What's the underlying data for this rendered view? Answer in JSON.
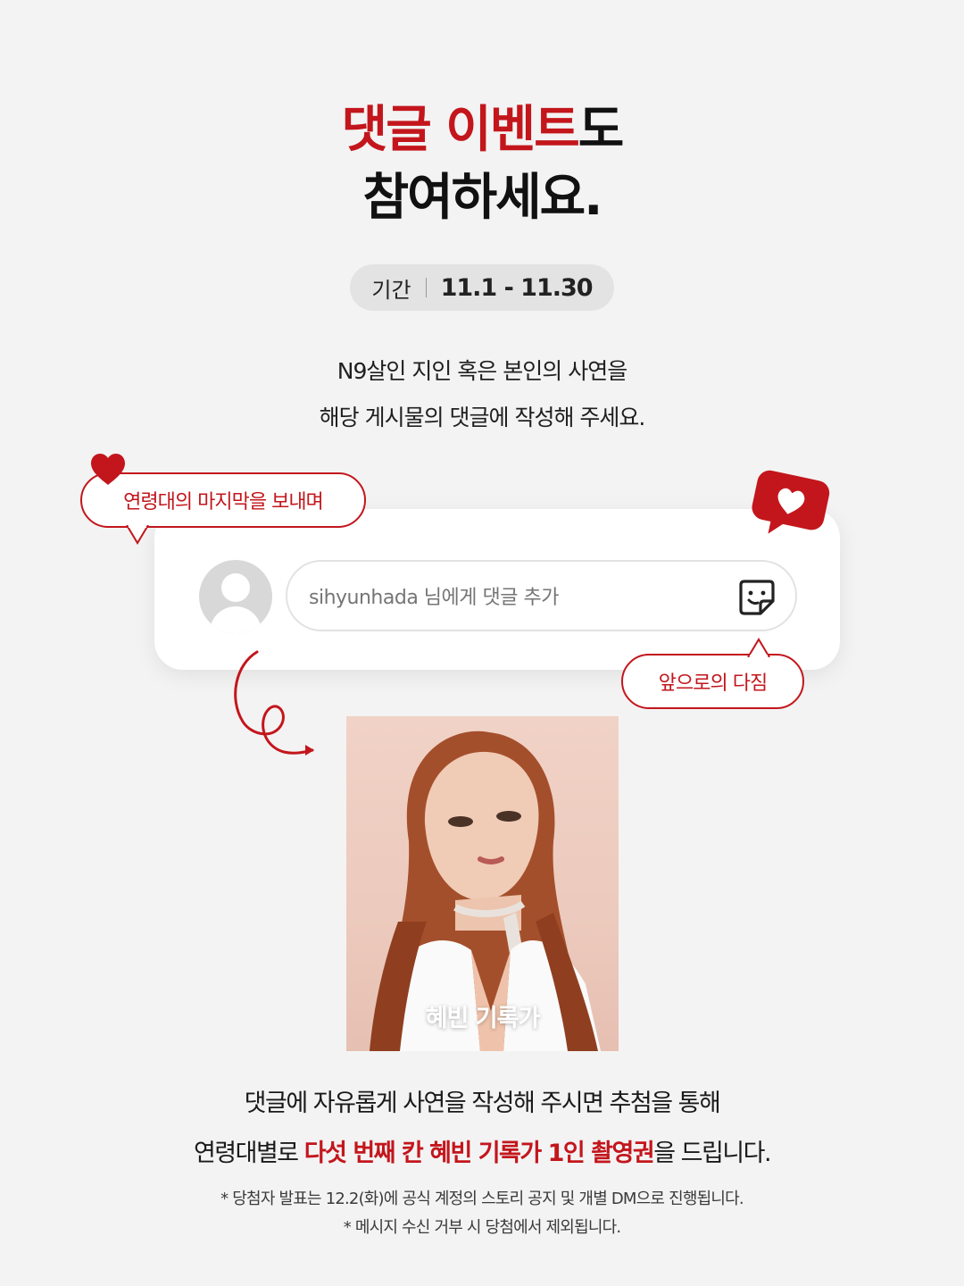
{
  "headline": {
    "line1_accent": "댓글 이벤트",
    "line1_rest": "도",
    "line2": "참여하세요."
  },
  "period": {
    "label": "기간",
    "dates": "11.1 - 11.30"
  },
  "intro": {
    "line1": "N9살인 지인 혹은 본인의 사연을",
    "line2": "해당 게시물의 댓글에 작성해 주세요."
  },
  "comment_box": {
    "placeholder": "sihyunhada 님에게 댓글 추가"
  },
  "bubbles": {
    "left": "연령대의 마지막을 보내며",
    "right": "앞으로의 다짐"
  },
  "photo": {
    "caption": "혜빈 기록가"
  },
  "details": {
    "line1": "댓글에 자유롭게 사연을 작성해 주시면 추첨을 통해",
    "line2_prefix": "연령대별로 ",
    "line2_highlight": "다섯 번째 칸 혜빈 기록가 1인 촬영권",
    "line2_suffix": "을 드립니다."
  },
  "notes": {
    "line1": "* 당첨자 발표는 12.2(화)에 공식 계정의 스토리 공지 및 개별 DM으로 진행됩니다.",
    "line2": "* 메시지 수신 거부 시 당첨에서 제외됩니다."
  },
  "colors": {
    "accent": "#c3161c",
    "background": "#f3f3f3"
  },
  "icons": [
    "heart-icon",
    "like-notification-icon",
    "sticker-icon",
    "avatar-placeholder-icon",
    "curl-arrow-icon"
  ]
}
